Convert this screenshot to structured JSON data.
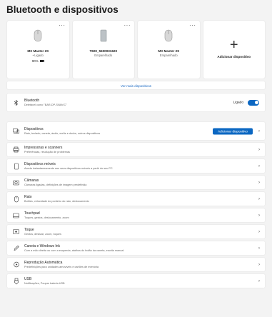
{
  "page": {
    "title": "Bluetooth e dispositivos"
  },
  "devices": [
    {
      "name": "MX Master 2S",
      "status": "• Ligado",
      "battery": "90%",
      "icon": "mouse-icon"
    },
    {
      "name": "T600_5500031620",
      "status": "Emparelhado",
      "icon": "device-icon"
    },
    {
      "name": "MX Master 2S",
      "status": "Emparelhado",
      "icon": "mouse-icon"
    }
  ],
  "add_card": {
    "label": "Adicionar dispositivo",
    "icon": "plus-icon"
  },
  "see_more": "Ver mais dispositivos",
  "bluetooth": {
    "title": "Bluetooth",
    "desc": "Detetável como \"BAR-DP-SNAV/C\"",
    "state": "Ligado"
  },
  "rows": [
    {
      "title": "Dispositivos",
      "desc": "Rato, teclado, caneta, áudio, ecrãs e docks, outros dispositivos",
      "icon": "devices-icon",
      "button": "Adicionar dispositivo"
    },
    {
      "title": "Impressoras e scanners",
      "desc": "Preferências, resolução de problemas",
      "icon": "printer-icon"
    },
    {
      "title": "Dispositivos móveis",
      "desc": "Aceda instantaneamente aos seus dispositivos móveis a partir do seu PC",
      "icon": "phone-icon"
    },
    {
      "title": "Câmaras",
      "desc": "Câmaras ligadas, definições de imagem predefinida",
      "icon": "camera-icon"
    },
    {
      "title": "Rato",
      "desc": "Botões, velocidade do ponteiro do rato, deslocamento",
      "icon": "mouse-icon"
    },
    {
      "title": "Touchpad",
      "desc": "Toques, gestos, deslocamento, zoom",
      "icon": "touchpad-icon"
    },
    {
      "title": "Toque",
      "desc": "Gestos, deslizar, zoom, toques",
      "icon": "touch-icon"
    },
    {
      "title": "Caneta e Windows Ink",
      "desc": "Com a mão direita ou com a esquerda, atalhos do botão da caneta, escrita manual",
      "icon": "pen-icon"
    },
    {
      "title": "Reprodução Automática",
      "desc": "Predefinições para unidades amovíveis e cartões de memória",
      "icon": "autoplay-icon"
    },
    {
      "title": "USB",
      "desc": "Notificações, Poupar bateria USB",
      "icon": "usb-icon"
    }
  ]
}
